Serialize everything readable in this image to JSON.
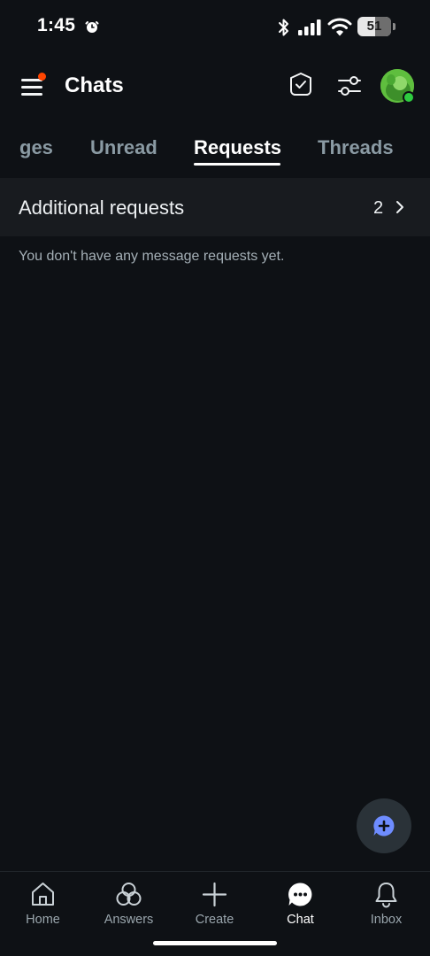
{
  "status_bar": {
    "time": "1:45",
    "battery": "51"
  },
  "header": {
    "title": "Chats"
  },
  "tabs": [
    {
      "label": "ges"
    },
    {
      "label": "Unread"
    },
    {
      "label": "Requests",
      "active": true
    },
    {
      "label": "Threads"
    }
  ],
  "requests": {
    "label": "Additional requests",
    "count": "2",
    "empty_message": "You don't have any message requests yet."
  },
  "bottom_nav": [
    {
      "label": "Home",
      "icon": "home-icon"
    },
    {
      "label": "Answers",
      "icon": "answers-icon"
    },
    {
      "label": "Create",
      "icon": "plus-icon"
    },
    {
      "label": "Chat",
      "icon": "chat-icon",
      "active": true
    },
    {
      "label": "Inbox",
      "icon": "bell-icon"
    }
  ],
  "colors": {
    "background": "#0e1115",
    "row_background": "#181b1f",
    "notification_dot": "#ff4500",
    "online_dot": "#2ecc40",
    "accent_blue": "#6e8cff"
  }
}
